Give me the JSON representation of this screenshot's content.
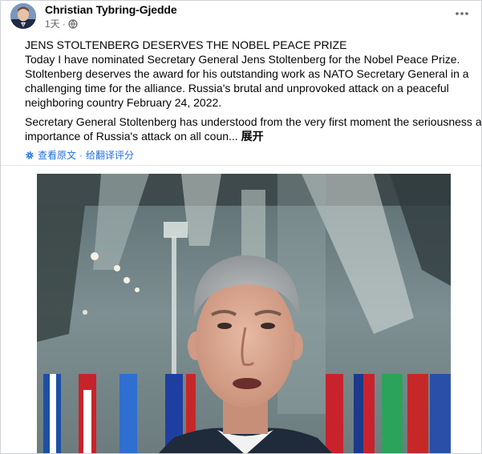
{
  "post": {
    "author": "Christian Tybring-Gjedde",
    "time": "1天",
    "privacy_icon": "globe-icon",
    "more_icon": "more-options-icon",
    "title_line": "JENS STOLTENBERG DESERVES THE NOBEL PEACE PRIZE",
    "paragraph1_lines": [
      "Today I have nominated Secretary General Jens Stoltenberg for the Nobel Peace Prize.",
      "Stoltenberg deserves the award for his outstanding work as NATO Secretary General in a",
      "challenging time for the alliance. Russia's brutal and unprovoked attack on a peaceful",
      "neighboring country February 24, 2022."
    ],
    "paragraph2_lines": [
      "Secretary General Stoltenberg has understood from the very first moment the seriousness and",
      "importance of Russia's attack on all coun..."
    ],
    "see_more": "展开",
    "see_original": "查看原文",
    "separator": "·",
    "rate_translation": "给翻译评分"
  },
  "colors": {
    "link_blue": "#216fdb",
    "meta_gray": "#65676b",
    "divider": "#e4e6eb"
  }
}
